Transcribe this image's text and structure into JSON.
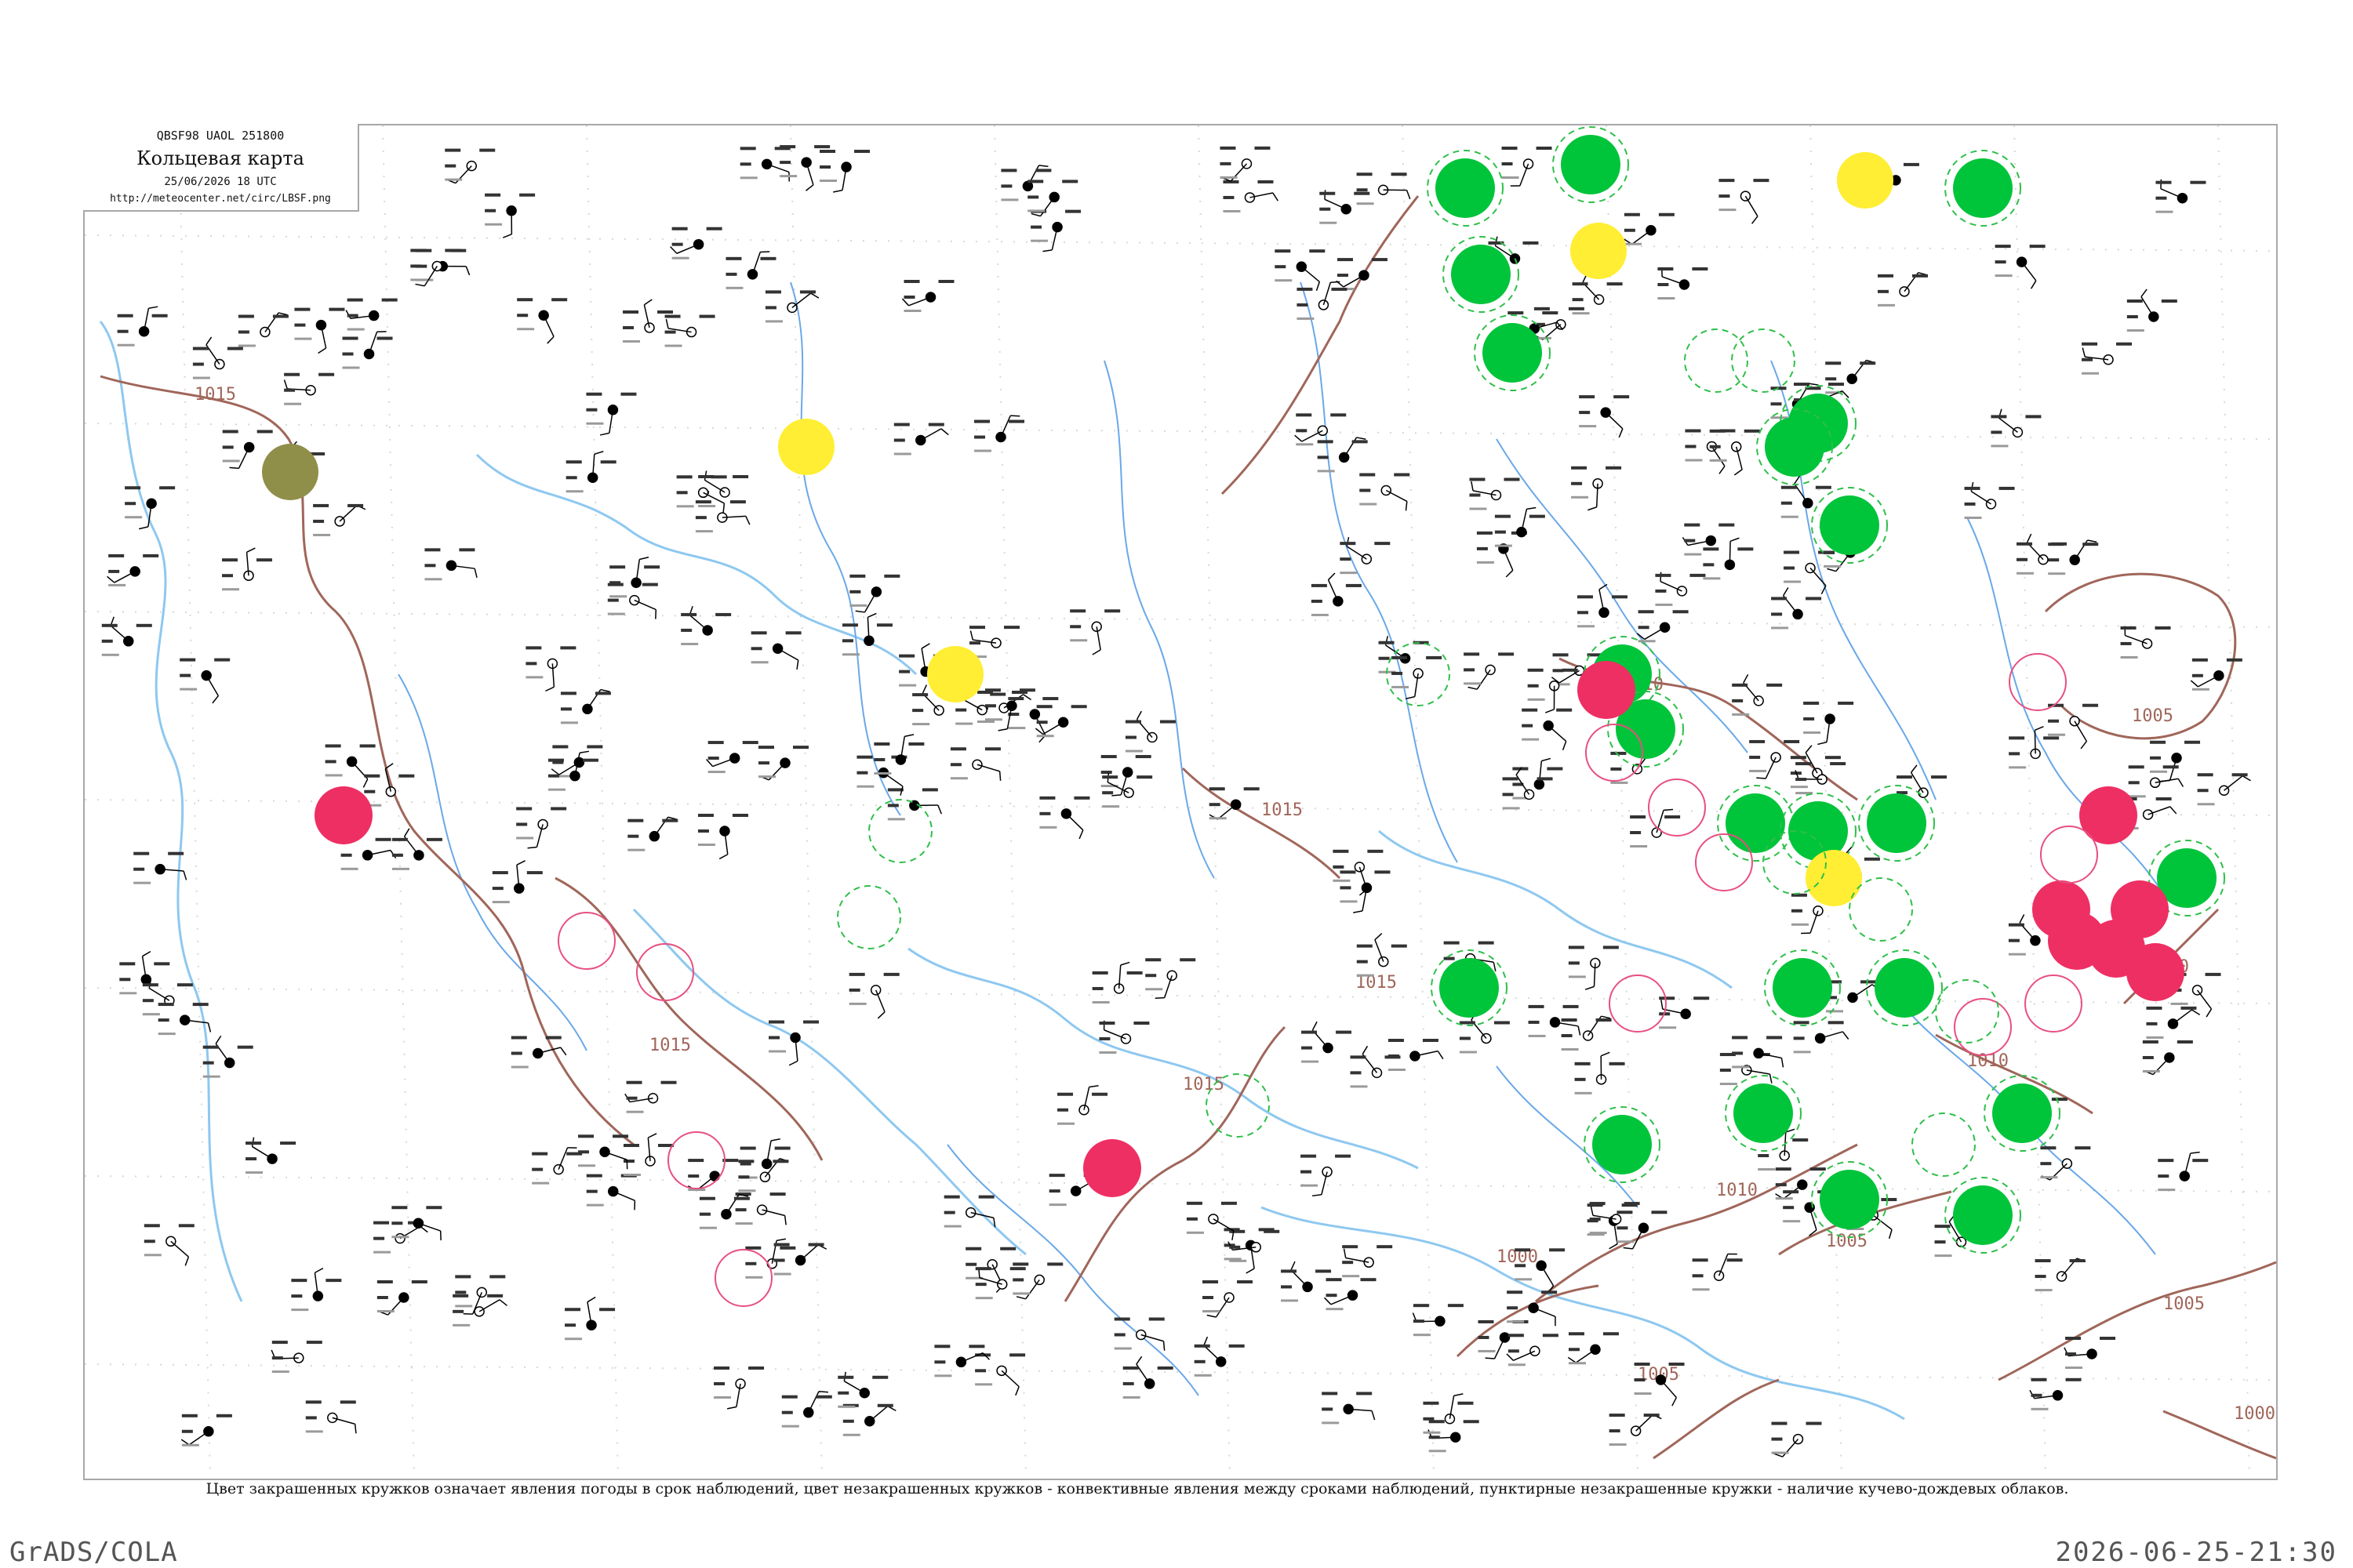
{
  "header": {
    "code": "QBSF98  UAOL  251800",
    "title": "Кольцевая карта",
    "datetime": "25/06/2026 18 UTC",
    "url": "http://meteocenter.net/circ/LBSF.png"
  },
  "legend_note": "Цвет закрашенных кружков означает явления погоды в срок наблюдений, цвет незакрашенных кружков - конвективные явления между сроками наблюдений, пунктирные незакрашенные кружки - наличие кучево-дождевых облаков.",
  "footer": {
    "software": "GrADS/COLA",
    "timestamp": "2026-06-25-21:30"
  },
  "isobar_labels": [
    "1015",
    "1015",
    "1015",
    "1015",
    "1015",
    "1010",
    "1010",
    "1010",
    "1010",
    "1005",
    "1005",
    "1005",
    "1005",
    "1000",
    "1000"
  ],
  "colors": {
    "rain_shower": "#00c43a",
    "fog_haze": "#ffee33",
    "thunderstorm": "#ee2f63",
    "smoke_dust": "#8f8f4a",
    "cb_cloud_dashed": "#2fbf4a",
    "thunder_between_obs": "#e85080",
    "isobar": "#a0665a",
    "river": "#6aa8e8",
    "coast": "#8ec8f0",
    "station_text": "#111111"
  },
  "weather_markers": {
    "filled_green": 22,
    "filled_red": 9,
    "filled_yellow": 5,
    "filled_olive": 1
  }
}
